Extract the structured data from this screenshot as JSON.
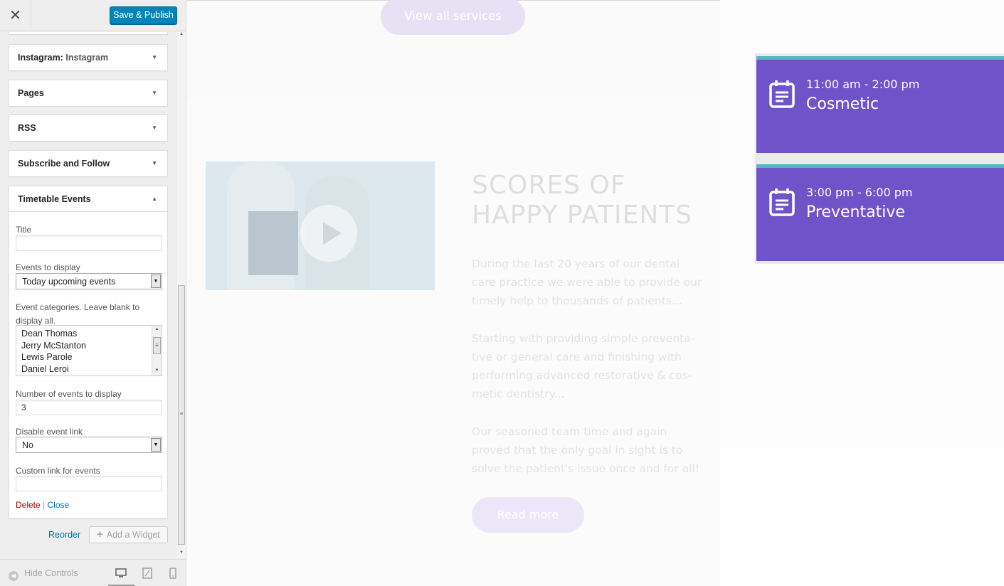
{
  "topbar": {
    "close_glyph": "✕",
    "save_label": "Save & Publish"
  },
  "panel": {
    "sections": [
      {
        "title": "Instagram:",
        "subtitle": "Instagram"
      },
      {
        "title": "Pages"
      },
      {
        "title": "RSS"
      },
      {
        "title": "Subscribe and Follow"
      },
      {
        "title": "Timetable Events"
      }
    ],
    "timetable": {
      "title_label": "Title",
      "title_value": "",
      "events_label": "Events to display",
      "events_value": "Today upcoming events",
      "categories_label": "Event categories. Leave blank to display all.",
      "categories": [
        "Dean Thomas",
        "Jerry McStanton",
        "Lewis Parole",
        "Daniel Leroi"
      ],
      "number_label": "Number of events to display",
      "number_value": "3",
      "disable_link_label": "Disable event link",
      "disable_link_value": "No",
      "custom_link_label": "Custom link for events",
      "custom_link_value": "",
      "delete_label": "Delete",
      "separator": "|",
      "close_label": "Close"
    },
    "reorder_label": "Reorder",
    "add_widget_label": "Add a Widget"
  },
  "footer": {
    "hide_controls_label": "Hide Controls"
  },
  "preview": {
    "view_all_label": "View all services",
    "heading_line1": "SCORES OF",
    "heading_line2": "HAPPY PATIENTS",
    "para1": "During the last 20 years of our dental care practice we were able to provide our timely help to thousands of patients...",
    "para2": "Starting with providing simple preventa-tive or general care and finishing with performing advanced restorative & cos-metic dentistry...",
    "para3": "Our seasoned team time and again proved that the only goal in sight is to solve the patient's issue once and for all!",
    "read_more_label": "Read more",
    "events": [
      {
        "time": "11:00 am - 2:00 pm",
        "title": "Cosmetic"
      },
      {
        "time": "3:00 pm - 6:00 pm",
        "title": "Preventative"
      }
    ]
  },
  "colors": {
    "accent_blue": "#0085ba",
    "event_purple": "#7053c9",
    "event_teal": "#4fb8c4",
    "delete_red": "#aa0000"
  },
  "icons": [
    "close-icon",
    "chevron-down-icon",
    "chevron-up-icon",
    "plus-icon",
    "arrow-left-circle-icon",
    "desktop-icon",
    "tablet-icon",
    "mobile-icon",
    "play-icon",
    "calendar-icon"
  ]
}
